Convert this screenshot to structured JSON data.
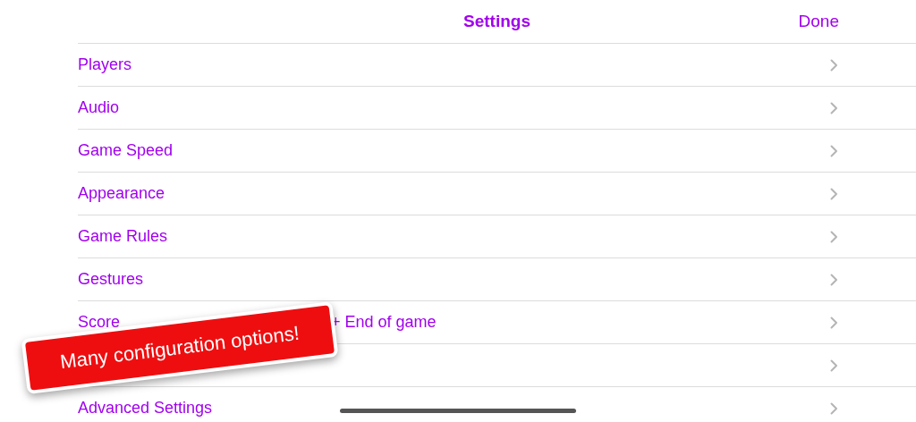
{
  "nav_bar": {
    "title": "Settings",
    "done": "Done"
  },
  "items": [
    {
      "label": "Players",
      "chevron": true
    },
    {
      "label": "Audio",
      "chevron": true
    },
    {
      "label": "Game Speed",
      "chevron": true
    },
    {
      "label": "Appearance",
      "chevron": true
    },
    {
      "label": "Game Rules",
      "chevron": true
    },
    {
      "label": "Gestures",
      "chevron": true
    },
    {
      "label": "Score",
      "label_tail": "+ End of game",
      "chevron": true
    },
    {
      "chevron": true
    },
    {
      "label": "Advanced Settings",
      "chevron": true
    }
  ],
  "banner": {
    "text": "Many configuration options!"
  }
}
